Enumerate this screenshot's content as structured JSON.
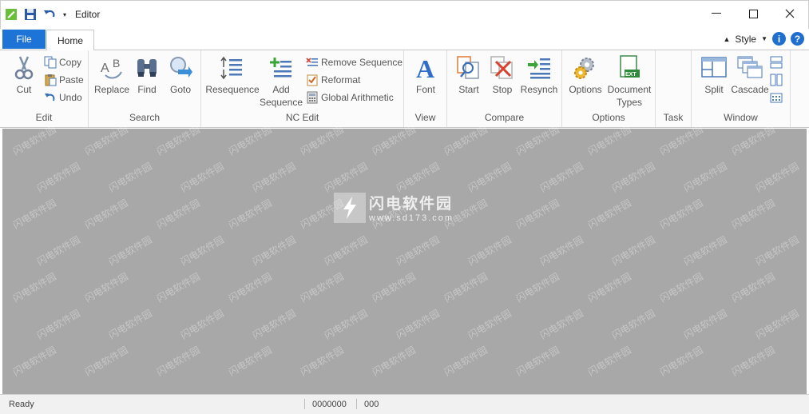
{
  "app": {
    "title": "Editor"
  },
  "tabs": {
    "file": "File",
    "home": "Home"
  },
  "style_menu": {
    "label": "Style"
  },
  "help": {
    "info": "i",
    "help": "?"
  },
  "ribbon": {
    "edit": {
      "label": "Edit",
      "cut": "Cut",
      "copy": "Copy",
      "paste": "Paste",
      "undo": "Undo"
    },
    "search": {
      "label": "Search",
      "replace": "Replace",
      "find": "Find",
      "goto": "Goto"
    },
    "nc_edit": {
      "label": "NC Edit",
      "resequence": "Resequence",
      "add_line1": "Add",
      "add_line2": "Sequence",
      "remove_sequence": "Remove Sequence",
      "reformat": "Reformat",
      "global_arithmetic": "Global Arithmetic"
    },
    "view": {
      "label": "View",
      "font": "Font"
    },
    "compare": {
      "label": "Compare",
      "start": "Start",
      "stop": "Stop",
      "resynch": "Resynch"
    },
    "options": {
      "label": "Options",
      "options": "Options",
      "doc_line1": "Document",
      "doc_line2": "Types",
      "ext_badge": "EXT"
    },
    "task": {
      "label": "Task"
    },
    "window": {
      "label": "Window",
      "split": "Split",
      "cascade": "Cascade"
    }
  },
  "watermark": {
    "brand": "闪电软件园",
    "url": "www.sd173.com"
  },
  "status": {
    "ready": "Ready",
    "position": "0000000",
    "col": "000"
  },
  "colors": {
    "accent": "#1e74d6",
    "workspace": "#a8a8a8"
  }
}
